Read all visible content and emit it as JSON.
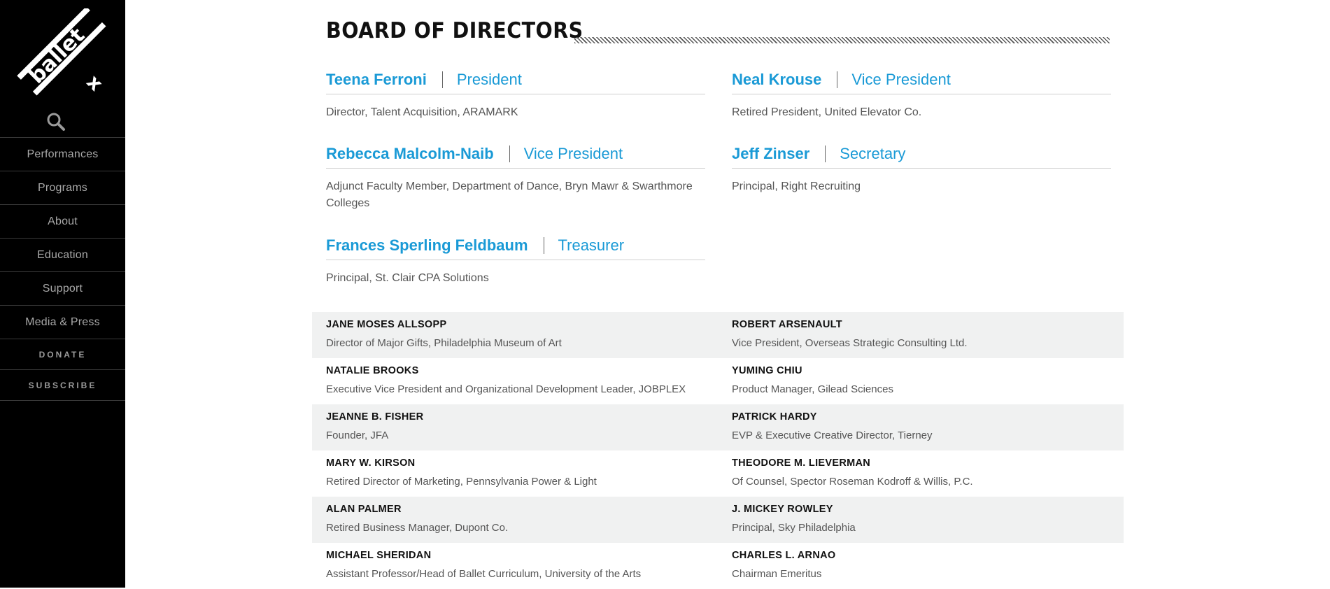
{
  "brand": {
    "logo_text": "ballet x",
    "logo_word_main": "ballet",
    "logo_word_x": "x"
  },
  "colors": {
    "accent": "#1a9ad6",
    "sidebar_bg": "#000000",
    "row_shade": "#f0f1f1"
  },
  "sidebar": {
    "search_icon": "search-icon",
    "items": [
      {
        "label": "Performances"
      },
      {
        "label": "Programs"
      },
      {
        "label": "About"
      },
      {
        "label": "Education"
      },
      {
        "label": "Support"
      },
      {
        "label": "Media & Press"
      },
      {
        "label": "DONATE"
      },
      {
        "label": "SUBSCRIBE"
      }
    ]
  },
  "page": {
    "title": "BOARD OF DIRECTORS"
  },
  "officers": [
    {
      "name": "Teena Ferroni",
      "role": "President",
      "desc": "Director, Talent Acquisition, ARAMARK"
    },
    {
      "name": "Neal Krouse",
      "role": "Vice President",
      "desc": "Retired President, United Elevator Co."
    },
    {
      "name": "Rebecca Malcolm-Naib",
      "role": "Vice President",
      "desc": "Adjunct Faculty Member, Department of Dance, Bryn Mawr & Swarthmore Colleges"
    },
    {
      "name": "Jeff Zinser",
      "role": "Secretary",
      "desc": "Principal, Right Recruiting"
    },
    {
      "name": "Frances Sperling Feldbaum",
      "role": "Treasurer",
      "desc": "Principal, St. Clair CPA Solutions"
    }
  ],
  "members": [
    [
      {
        "name": "JANE MOSES ALLSOPP",
        "desc": "Director of Major Gifts, Philadelphia Museum of Art"
      },
      {
        "name": "ROBERT ARSENAULT",
        "desc": "Vice President, Overseas Strategic Consulting Ltd."
      }
    ],
    [
      {
        "name": "NATALIE BROOKS",
        "desc": "Executive Vice President and Organizational Development Leader, JOBPLEX"
      },
      {
        "name": "YUMING CHIU",
        "desc": "Product Manager, Gilead Sciences"
      }
    ],
    [
      {
        "name": "JEANNE B. FISHER",
        "desc": "Founder, JFA"
      },
      {
        "name": "PATRICK HARDY",
        "desc": "EVP & Executive Creative Director, Tierney"
      }
    ],
    [
      {
        "name": "MARY W. KIRSON",
        "desc": "Retired Director of Marketing, Pennsylvania Power & Light"
      },
      {
        "name": "THEODORE M. LIEVERMAN",
        "desc": "Of Counsel, Spector Roseman Kodroff & Willis, P.C."
      }
    ],
    [
      {
        "name": "ALAN PALMER",
        "desc": "Retired Business Manager, Dupont Co."
      },
      {
        "name": "J. MICKEY ROWLEY",
        "desc": "Principal, Sky Philadelphia"
      }
    ],
    [
      {
        "name": "MICHAEL SHERIDAN",
        "desc": "Assistant Professor/Head of Ballet Curriculum, University of the Arts"
      },
      {
        "name": "CHARLES L. ARNAO",
        "desc": "Chairman Emeritus"
      }
    ]
  ]
}
